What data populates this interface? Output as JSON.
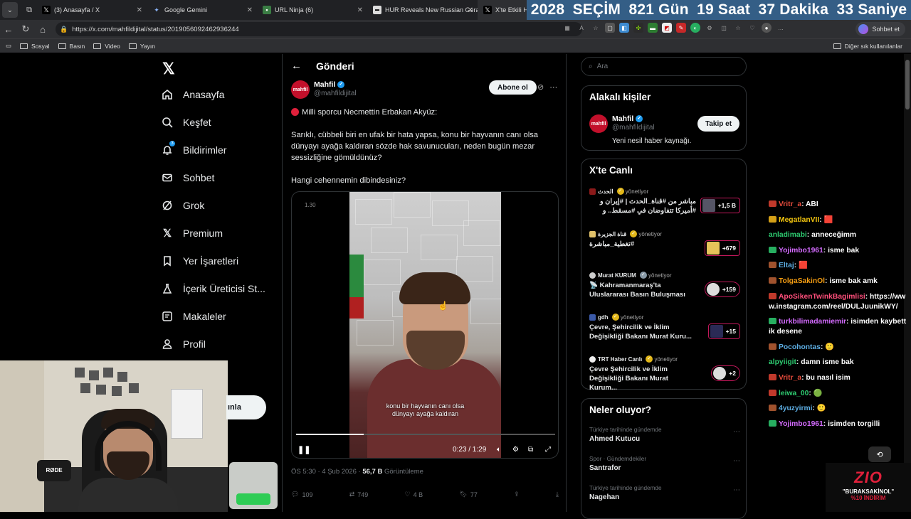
{
  "browser": {
    "tabs": [
      {
        "title": "(3) Anasayfa / X",
        "icon": "x-icon",
        "active": false
      },
      {
        "title": "Google Gemini",
        "icon": "gemini-icon",
        "active": false
      },
      {
        "title": "URL Ninja (6)",
        "icon": "url-ninja-icon",
        "active": false
      },
      {
        "title": "HUR Reveals New Russian Geran",
        "icon": "news-icon",
        "active": false
      },
      {
        "title": "X'te Etkili Hab",
        "icon": "x-icon",
        "active": true
      }
    ],
    "countdown": {
      "year": "2028",
      "label": "SEÇİM",
      "days": "821 Gün",
      "hours": "19 Saat",
      "minutes": "37 Dakika",
      "seconds": "33 Saniye"
    },
    "url": "https://x.com/mahfildijital/status/2019056092462936244",
    "chat_button": "Sohbet et",
    "bookmarks": [
      "Sosyal",
      "Basın",
      "Video",
      "Yayın"
    ],
    "bookmarks_other": "Diğer sık kullanılanlar"
  },
  "nav": {
    "items": [
      {
        "label": "Anasayfa",
        "icon": "home-icon"
      },
      {
        "label": "Keşfet",
        "icon": "search-icon"
      },
      {
        "label": "Bildirimler",
        "icon": "bell-icon",
        "badge": "3"
      },
      {
        "label": "Sohbet",
        "icon": "mail-icon"
      },
      {
        "label": "Grok",
        "icon": "grok-icon"
      },
      {
        "label": "Premium",
        "icon": "x-icon"
      },
      {
        "label": "Yer İşaretleri",
        "icon": "bookmark-icon"
      },
      {
        "label": "İçerik Üreticisi St...",
        "icon": "flask-icon"
      },
      {
        "label": "Makaleler",
        "icon": "article-icon"
      },
      {
        "label": "Profil",
        "icon": "person-icon"
      }
    ],
    "post_button_fragment": "ınla"
  },
  "post": {
    "header": "Gönderi",
    "author_name": "Mahfil",
    "author_handle": "@mahfildijital",
    "avatar_text": "mahfil",
    "subscribe": "Abone ol",
    "line1": "Milli sporcu Necmettin Erbakan Akyüz:",
    "line2": "Sarıklı, cübbeli biri en ufak bir hata yapsa, konu bir hayvanın canı olsa dünyayı ayağa kaldıran sözde hak savunucuları, neden bugün mezar sessizliğine gömüldünüz?",
    "line3": "Hangi cehennemin dibindesiniz?",
    "video": {
      "top_time": "1.30",
      "subtitle_l1": "konu bir hayvanın canı olsa",
      "subtitle_l2": "dünyayı ayağa kaldıran",
      "time": "0:23 / 1:29",
      "progress": 0.26
    },
    "meta_time": "ÖS 5:30 · 4 Şub 2026 · ",
    "views": "56,7 B",
    "views_label": " Görüntüleme",
    "replies": "109",
    "reposts": "749",
    "likes": "4 B",
    "bookmarks": "77"
  },
  "sidebar": {
    "search_placeholder": "Ara",
    "related_title": "Alakalı kişiler",
    "related": {
      "name": "Mahfil",
      "handle": "@mahfildijital",
      "bio": "Yeni nesil haber kaynağı.",
      "follow": "Takip et"
    },
    "live_title": "X'te Canlı",
    "live": [
      {
        "host": "الحدث",
        "status": "yönetiyor",
        "title": "مباشر من #قناة_الحدث | #إيران و #أميركا تتفاوضان في #مسقط.. و",
        "count": "+1,5 B",
        "round": false
      },
      {
        "host": "قناة الجزيرة",
        "status": "yönetiyor",
        "title": "#تغطية_مباشرة",
        "count": "+679",
        "round": false
      },
      {
        "host": "Murat KURUM",
        "status": "yönetiyor",
        "title": "📡 Kahramanmaraş'ta Uluslararası Basın Buluşması",
        "count": "+159",
        "round": true
      },
      {
        "host": "gdh",
        "status": "yönetiyor",
        "title": "Çevre, Şehircilik ve İklim Değişikliği Bakanı Murat Kuru...",
        "count": "+15",
        "round": false
      },
      {
        "host": "TRT Haber Canlı",
        "status": "yönetiyor",
        "title": "Çevre Şehircilik ve İklim Değişikliği Bakanı Murat Kurum...",
        "count": "+2",
        "round": true
      }
    ],
    "trends_title": "Neler oluyor?",
    "trends": [
      {
        "category": "Türkiye tarihinde gündemde",
        "name": "Ahmed Kutucu"
      },
      {
        "category": "Spor · Gündemdekiler",
        "name": "Santrafor"
      },
      {
        "category": "Türkiye tarihinde gündemde",
        "name": "Nagehan"
      }
    ]
  },
  "chat": [
    {
      "user": "Vritr_a",
      "color": "#e74c3c",
      "badge": "#c0392b",
      "msg": "ABI"
    },
    {
      "user": "MegatlanVII",
      "color": "#f1c40f",
      "badge": "#d4a017",
      "msg": "🟥"
    },
    {
      "user": "anladimabi",
      "color": "#2ecc71",
      "badge": "",
      "msg": "anneceğimm"
    },
    {
      "user": "Yojimbo1961",
      "color": "#d46bff",
      "badge": "#27ae60",
      "msg": "isme bak"
    },
    {
      "user": "Eltaj",
      "color": "#5dade2",
      "badge": "#a0522d",
      "msg": "🟥"
    },
    {
      "user": "TolgaSakinOl",
      "color": "#f39c12",
      "badge": "#a0522d",
      "msg": "isme bak amk"
    },
    {
      "user": "ApoSikenTwinkBagimlisi",
      "color": "#ff4f7b",
      "badge": "#c0392b",
      "msg": "https://www.instagram.com/reel/DULJuunikWY/"
    },
    {
      "user": "turkbilimadamiemir",
      "color": "#d46bff",
      "badge": "#27ae60",
      "msg": "isimden kaybettik desene"
    },
    {
      "user": "Pocohontas",
      "color": "#5dade2",
      "badge": "#a0522d",
      "msg": "🙂"
    },
    {
      "user": "alpyiigit",
      "color": "#2ecc71",
      "badge": "",
      "msg": "damn isme bak"
    },
    {
      "user": "Vritr_a",
      "color": "#e74c3c",
      "badge": "#c0392b",
      "msg": "bu nasıl isim"
    },
    {
      "user": "leiwa_00",
      "color": "#2ecc71",
      "badge": "#c0392b",
      "msg": "🟢"
    },
    {
      "user": "4yuzyirmi",
      "color": "#5dade2",
      "badge": "#a0522d",
      "msg": "🙂"
    },
    {
      "user": "Yojimbo1961",
      "color": "#d46bff",
      "badge": "#27ae60",
      "msg": "isimden torgilli"
    }
  ],
  "webcam": {
    "mic_brand": "RØDE"
  },
  "brand": {
    "logo": "ZIO",
    "line1": "\"BURAKSAKİNOL\"",
    "line2": "%10 İNDİRİM"
  }
}
